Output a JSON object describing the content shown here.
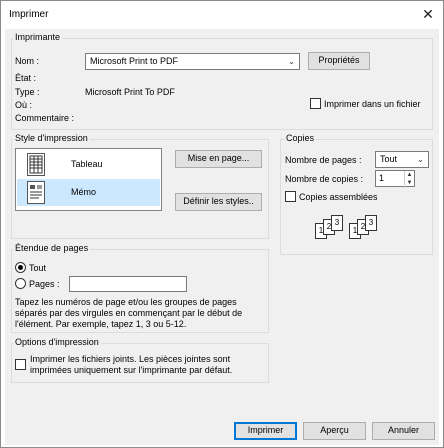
{
  "window": {
    "title": "Imprimer"
  },
  "printer": {
    "group_label": "Imprimante",
    "name_label": "Nom :",
    "name_value": "Microsoft Print to PDF",
    "properties_button": "Propriétés",
    "status_label": "État :",
    "type_label": "Type :",
    "type_value": "Microsoft Print To PDF",
    "where_label": "Où :",
    "comment_label": "Commentaire :",
    "print_to_file_label": "Imprimer dans un fichier"
  },
  "style": {
    "group_label": "Style d'impression",
    "items": [
      {
        "label": "Tableau",
        "icon": "table-style-icon"
      },
      {
        "label": "Mémo",
        "icon": "memo-style-icon"
      }
    ],
    "page_setup_button": "Mise en page...",
    "define_styles_button": "Définir les styles.."
  },
  "copies": {
    "group_label": "Copies",
    "pages_label": "Nombre de pages :",
    "pages_value": "Tout",
    "copies_label": "Nombre de copies :",
    "copies_value": "1",
    "collate_label": "Copies assemblées",
    "collate_pages": [
      "1",
      "1",
      "2",
      "2",
      "3",
      "3"
    ]
  },
  "range": {
    "group_label": "Étendue de pages",
    "all_label": "Tout",
    "pages_label": "Pages :",
    "help_text_1": "Tapez les numéros de page et/ou les groupes de pages",
    "help_text_2": "séparés par des virgules en commençant par le début de",
    "help_text_3": "l'élément. Par exemple, tapez 1, 3 ou 5-12."
  },
  "options": {
    "group_label": "Options d'impression",
    "attachments_line1": "Imprimer les fichiers joints. Les pièces jointes sont",
    "attachments_line2": "imprimées uniquement sur l'imprimante par défaut."
  },
  "footer": {
    "print_button": "Imprimer",
    "preview_button": "Aperçu",
    "cancel_button": "Annuler"
  }
}
